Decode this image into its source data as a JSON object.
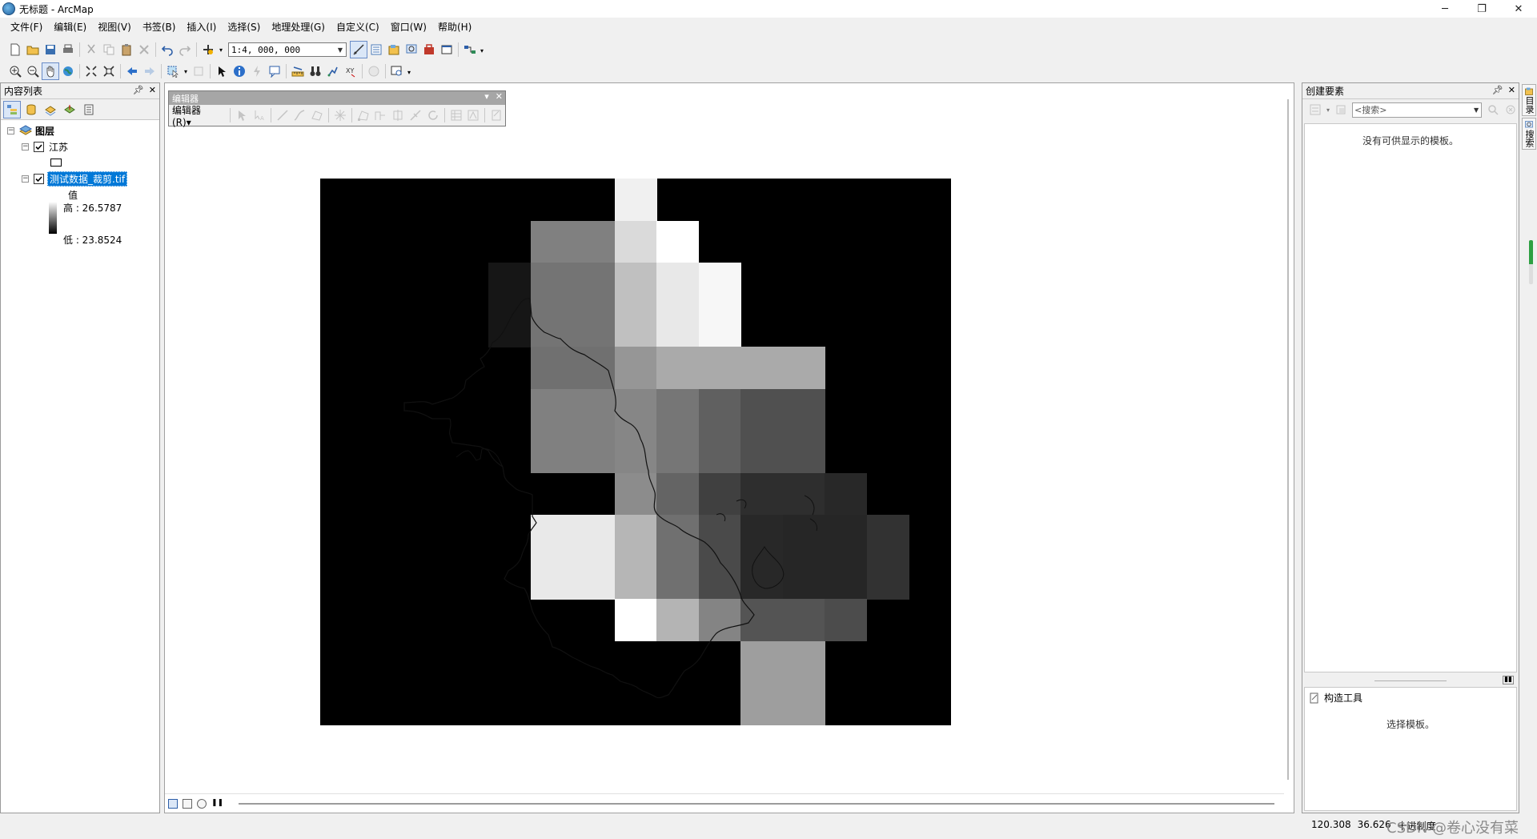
{
  "window": {
    "title": "无标题 - ArcMap",
    "minimize": "─",
    "maximize": "❐",
    "close": "✕"
  },
  "menu": [
    "文件(F)",
    "编辑(E)",
    "视图(V)",
    "书签(B)",
    "插入(I)",
    "选择(S)",
    "地理处理(G)",
    "自定义(C)",
    "窗口(W)",
    "帮助(H)"
  ],
  "standard_toolbar": {
    "scale": "1:4, 000, 000"
  },
  "toc": {
    "title": "内容列表",
    "root": "图层",
    "layers": [
      {
        "name": "江苏",
        "checked": true
      },
      {
        "name": "测试数据_裁剪.tif",
        "checked": true,
        "selected": true,
        "legend_heading": "值",
        "high": "高 : 26.5787",
        "low": "低 : 23.8524"
      }
    ]
  },
  "editor_toolbar": {
    "title": "编辑器",
    "menu": "编辑器(R)▾"
  },
  "create_features": {
    "title": "创建要素",
    "search_placeholder": "<搜索>",
    "empty_message": "没有可供显示的模板。",
    "construction_title": "构造工具",
    "construction_hint": "选择模板。"
  },
  "dock_tabs": [
    "目录",
    "搜索"
  ],
  "dock_progress_fraction": 0.55,
  "status": {
    "x": "120.308",
    "y": "36.626",
    "unit": "十进制度"
  },
  "watermark": "CSDN @卷心没有菜",
  "raster": {
    "grid_cols": 15,
    "grid_rows": 13,
    "cells": [
      {
        "col": 7,
        "row": 0,
        "gray": 240
      },
      {
        "col": 5,
        "row": 1,
        "gray": 128
      },
      {
        "col": 6,
        "row": 1,
        "gray": 128
      },
      {
        "col": 7,
        "row": 1,
        "gray": 218
      },
      {
        "col": 8,
        "row": 1,
        "gray": 255
      },
      {
        "col": 4,
        "row": 2,
        "gray": 22
      },
      {
        "col": 5,
        "row": 2,
        "gray": 116
      },
      {
        "col": 6,
        "row": 2,
        "gray": 116
      },
      {
        "col": 7,
        "row": 2,
        "gray": 192
      },
      {
        "col": 8,
        "row": 2,
        "gray": 232
      },
      {
        "col": 9,
        "row": 2,
        "gray": 247
      },
      {
        "col": 4,
        "row": 3,
        "gray": 22
      },
      {
        "col": 5,
        "row": 3,
        "gray": 116
      },
      {
        "col": 6,
        "row": 3,
        "gray": 116
      },
      {
        "col": 7,
        "row": 3,
        "gray": 192
      },
      {
        "col": 8,
        "row": 3,
        "gray": 232
      },
      {
        "col": 9,
        "row": 3,
        "gray": 247
      },
      {
        "col": 5,
        "row": 4,
        "gray": 112
      },
      {
        "col": 6,
        "row": 4,
        "gray": 112
      },
      {
        "col": 7,
        "row": 4,
        "gray": 150
      },
      {
        "col": 8,
        "row": 4,
        "gray": 170
      },
      {
        "col": 9,
        "row": 4,
        "gray": 170
      },
      {
        "col": 10,
        "row": 4,
        "gray": 170
      },
      {
        "col": 11,
        "row": 4,
        "gray": 170
      },
      {
        "col": 5,
        "row": 5,
        "gray": 128
      },
      {
        "col": 6,
        "row": 5,
        "gray": 128
      },
      {
        "col": 7,
        "row": 5,
        "gray": 134
      },
      {
        "col": 8,
        "row": 5,
        "gray": 118
      },
      {
        "col": 9,
        "row": 5,
        "gray": 96
      },
      {
        "col": 10,
        "row": 5,
        "gray": 80
      },
      {
        "col": 11,
        "row": 5,
        "gray": 80
      },
      {
        "col": 5,
        "row": 6,
        "gray": 128
      },
      {
        "col": 6,
        "row": 6,
        "gray": 128
      },
      {
        "col": 7,
        "row": 6,
        "gray": 134
      },
      {
        "col": 8,
        "row": 6,
        "gray": 118
      },
      {
        "col": 9,
        "row": 6,
        "gray": 96
      },
      {
        "col": 10,
        "row": 6,
        "gray": 80
      },
      {
        "col": 11,
        "row": 6,
        "gray": 80
      },
      {
        "col": 7,
        "row": 7,
        "gray": 140
      },
      {
        "col": 8,
        "row": 7,
        "gray": 100
      },
      {
        "col": 9,
        "row": 7,
        "gray": 64
      },
      {
        "col": 10,
        "row": 7,
        "gray": 46
      },
      {
        "col": 11,
        "row": 7,
        "gray": 46
      },
      {
        "col": 12,
        "row": 7,
        "gray": 40
      },
      {
        "col": 5,
        "row": 8,
        "gray": 233
      },
      {
        "col": 6,
        "row": 8,
        "gray": 233
      },
      {
        "col": 7,
        "row": 8,
        "gray": 182
      },
      {
        "col": 8,
        "row": 8,
        "gray": 112
      },
      {
        "col": 9,
        "row": 8,
        "gray": 74
      },
      {
        "col": 10,
        "row": 8,
        "gray": 40
      },
      {
        "col": 11,
        "row": 8,
        "gray": 38
      },
      {
        "col": 12,
        "row": 8,
        "gray": 38
      },
      {
        "col": 13,
        "row": 8,
        "gray": 50
      },
      {
        "col": 5,
        "row": 9,
        "gray": 233
      },
      {
        "col": 6,
        "row": 9,
        "gray": 233
      },
      {
        "col": 7,
        "row": 9,
        "gray": 182
      },
      {
        "col": 8,
        "row": 9,
        "gray": 112
      },
      {
        "col": 9,
        "row": 9,
        "gray": 74
      },
      {
        "col": 10,
        "row": 9,
        "gray": 40
      },
      {
        "col": 11,
        "row": 9,
        "gray": 38
      },
      {
        "col": 12,
        "row": 9,
        "gray": 38
      },
      {
        "col": 13,
        "row": 9,
        "gray": 50
      },
      {
        "col": 7,
        "row": 10,
        "gray": 255
      },
      {
        "col": 8,
        "row": 10,
        "gray": 180
      },
      {
        "col": 9,
        "row": 10,
        "gray": 132
      },
      {
        "col": 10,
        "row": 10,
        "gray": 84
      },
      {
        "col": 11,
        "row": 10,
        "gray": 84
      },
      {
        "col": 12,
        "row": 10,
        "gray": 76
      },
      {
        "col": 10,
        "row": 11,
        "gray": 158
      },
      {
        "col": 11,
        "row": 11,
        "gray": 158
      },
      {
        "col": 10,
        "row": 12,
        "gray": 158
      },
      {
        "col": 11,
        "row": 12,
        "gray": 158
      }
    ]
  }
}
